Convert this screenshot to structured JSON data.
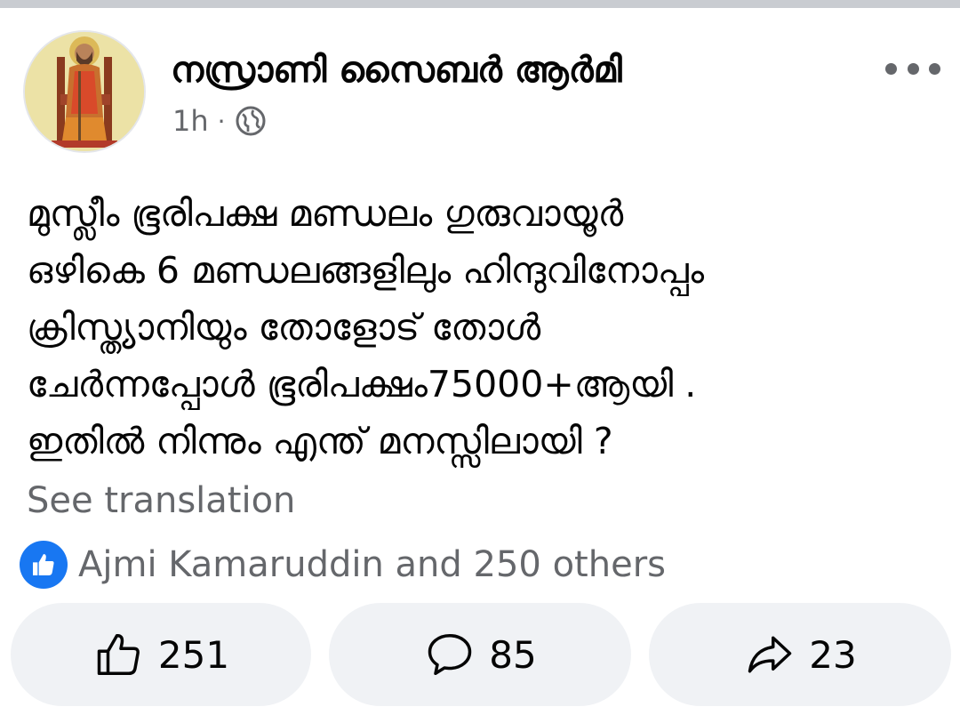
{
  "post": {
    "page_name": "നസ്രാണി സൈബർ ആർമി",
    "time": "1h",
    "separator": "·",
    "privacy_icon": "globe-icon",
    "lines": [
      "മുസ്ലീം ഭൂരിപക്ഷ മണ്ഡലം ഗുരുവായൂർ",
      "ഒഴികെ 6 മണ്ഡലങ്ങളിലും ഹിന്ദുവിനോപ്പം",
      "ക്രിസ്ത്യാനിയും തോളോട് തോൾ",
      "ചേർന്നപ്പോൾ ഭൂരിപക്ഷം75000+ആയി .",
      "ഇതിൽ നിന്നും എന്ത് മനസ്സിലായി ?"
    ],
    "see_translation": "See translation",
    "reactions_text": "Ajmi Kamaruddin and 250 others"
  },
  "actions": {
    "like_count": "251",
    "comment_count": "85",
    "share_count": "23"
  },
  "colors": {
    "accent": "#1877f2",
    "secondary_text": "#65676b",
    "button_bg": "#f0f2f5"
  }
}
